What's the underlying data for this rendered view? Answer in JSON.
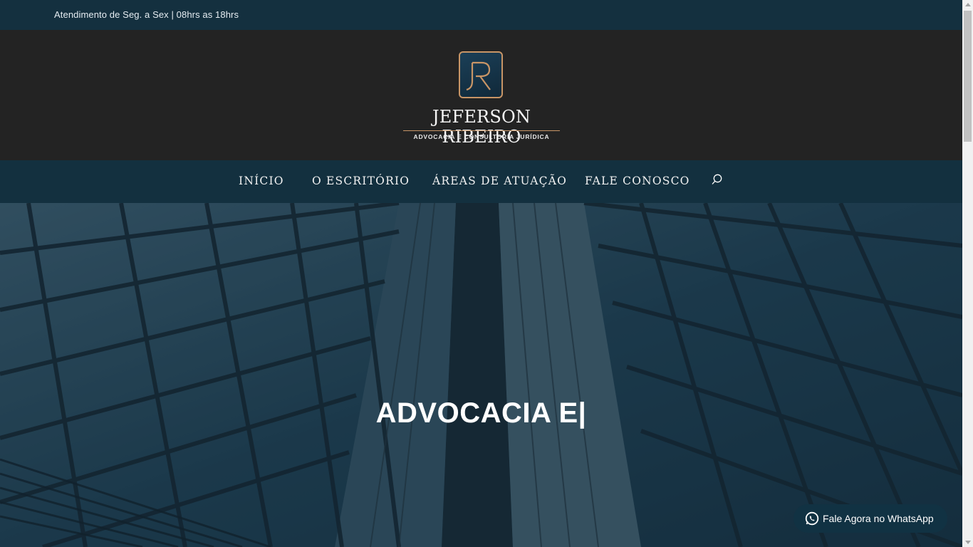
{
  "topbar": {
    "info": "Atendimento de Seg. a Sex | 08hrs as 18hrs"
  },
  "logo": {
    "monogram": "JR",
    "brand": "JEFERSON RIBEIRO",
    "tagline": "ADVOCACIA E CONSULTORIA JURÍDICA",
    "accent_color": "#c89566"
  },
  "nav": {
    "items": [
      {
        "label": "INÍCIO"
      },
      {
        "label": "O ESCRITÓRIO"
      },
      {
        "label": "ÁREAS DE ATUAÇÃO"
      },
      {
        "label": "FALE CONOSCO"
      }
    ],
    "search_icon": "search-icon"
  },
  "hero": {
    "headline": "ADVOCACIA E|"
  },
  "whatsapp": {
    "label": "Fale Agora no WhatsApp",
    "icon": "whatsapp-icon"
  }
}
